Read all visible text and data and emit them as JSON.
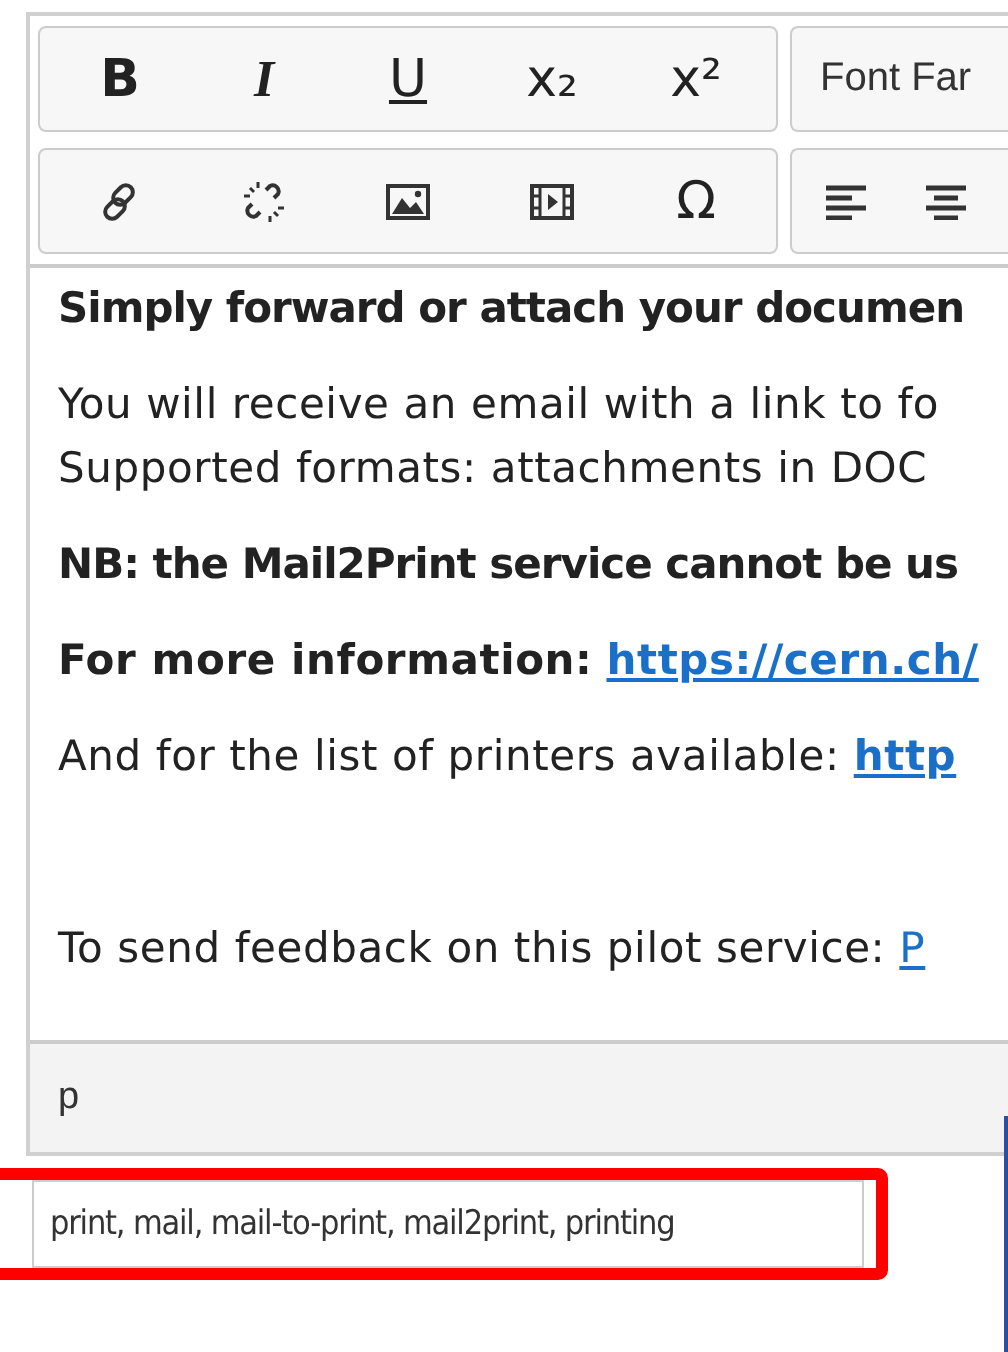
{
  "toolbar": {
    "row_1": [
      {
        "kind": "bold",
        "label": "B"
      },
      {
        "kind": "italic",
        "label": "I"
      },
      {
        "kind": "underline",
        "label": "U"
      },
      {
        "kind": "text",
        "label": "x₂"
      },
      {
        "kind": "text",
        "label": "x²"
      }
    ],
    "font_family": {
      "label": "Font Far"
    },
    "row_2": [
      {
        "kind": "link"
      },
      {
        "kind": "unlink"
      },
      {
        "kind": "image"
      },
      {
        "kind": "video"
      },
      {
        "kind": "text",
        "label": "Ω"
      }
    ],
    "row_2_right": [
      {
        "kind": "align-left"
      },
      {
        "kind": "align-center"
      }
    ]
  },
  "content": [
    {
      "kind": "bold",
      "text": "Simply forward or attach your documen"
    },
    {
      "kind": "plain",
      "lines": [
        "You will receive an email with a link to fo",
        "Supported formats: attachments in DOC"
      ]
    },
    {
      "kind": "bold",
      "text": "NB: the Mail2Print service cannot be us"
    },
    {
      "kind": "link",
      "text": "**For more information:** ",
      "link": "**https://cern.ch/**"
    },
    {
      "kind": "link",
      "text": "And for the list of printers available: ",
      "link": "**http**"
    },
    {
      "kind": "blank"
    },
    {
      "kind": "link",
      "text": "To send feedback on this pilot service: ",
      "link": "P"
    }
  ],
  "status_bar": {
    "path": "p"
  },
  "tags_field": {
    "value": "print, mail, mail-to-print, mail2print, printing",
    "highlighted": true
  }
}
